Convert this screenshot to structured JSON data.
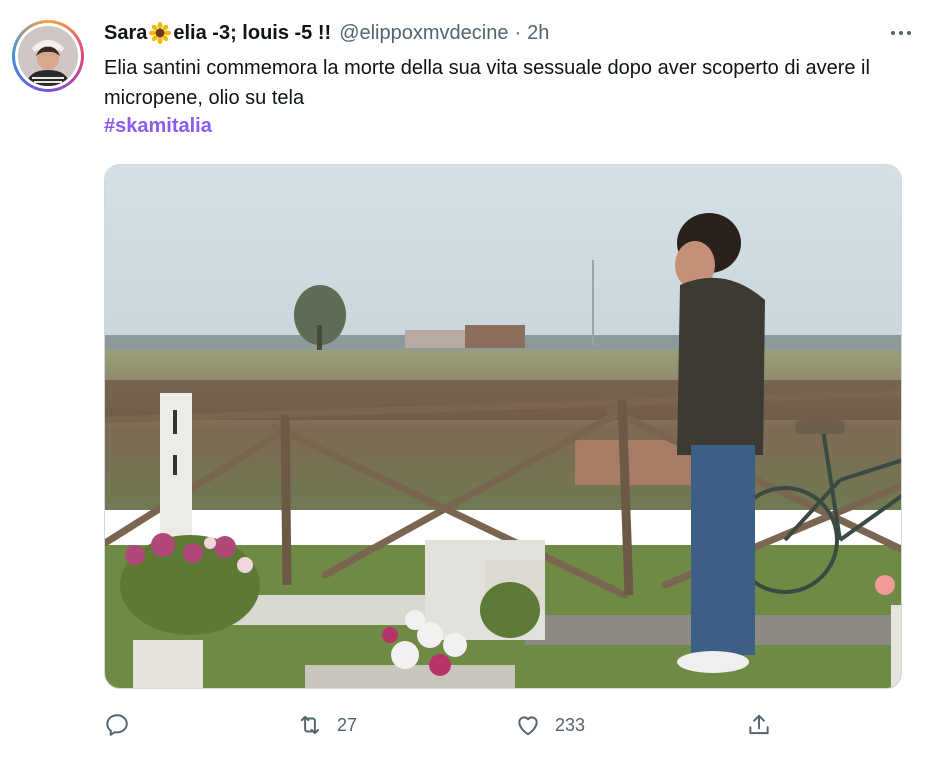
{
  "tweet": {
    "display_name": "Sara",
    "display_name_suffix": "elia -3; louis -5 !!",
    "handle": "@elippoxmvdecine",
    "separator": "·",
    "time": "2h",
    "text": "Elia santini commemora la morte della sua vita sessuale dopo aver scoperto di avere il micropene, olio su tela",
    "hashtag": "#skamitalia",
    "emoji": "sunflower-icon"
  },
  "actions": {
    "reply_count": "",
    "retweet_count": "27",
    "like_count": "233"
  },
  "colors": {
    "hashtag": "#8a5cf0",
    "secondary_text": "#536471",
    "primary_text": "#0f1419"
  }
}
